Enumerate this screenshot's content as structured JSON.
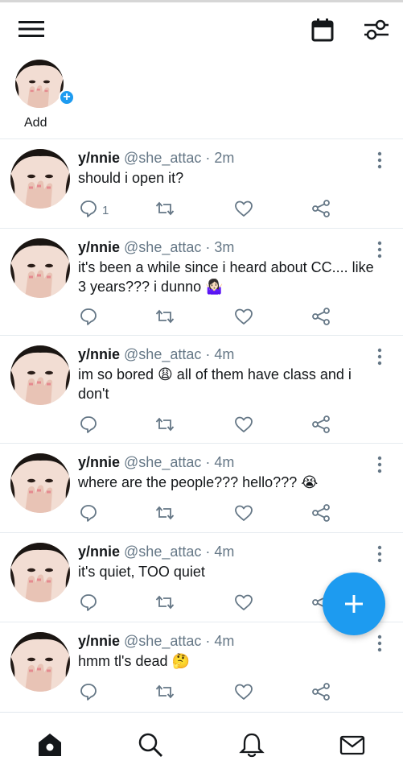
{
  "colors": {
    "accent": "#1d9bf0",
    "text": "#14171a",
    "muted": "#657786",
    "divider": "#e6ecf0"
  },
  "topbar": {
    "menu_icon": "hamburger-menu-icon",
    "calendar_icon": "calendar-icon",
    "filter_icon": "sliders-icon"
  },
  "fleets": {
    "add_label": "Add"
  },
  "tweets": [
    {
      "name": "y/nnie",
      "meta": "@she_attac · 2m",
      "text": "should i open it?",
      "reply_count": "1"
    },
    {
      "name": "y/nnie",
      "meta": "@she_attac · 3m",
      "text": "it's been a while since i heard about CC.... like 3 years??? i dunno 🤷🏻‍♀️",
      "reply_count": ""
    },
    {
      "name": "y/nnie",
      "meta": "@she_attac · 4m",
      "text": "im so bored 😩 all of them have class and i don't",
      "reply_count": ""
    },
    {
      "name": "y/nnie",
      "meta": "@she_attac · 4m",
      "text": "where are the people??? hello??? 😭",
      "reply_count": ""
    },
    {
      "name": "y/nnie",
      "meta": "@she_attac · 4m",
      "text": "it's quiet, TOO quiet",
      "reply_count": ""
    },
    {
      "name": "y/nnie",
      "meta": "@she_attac · 4m",
      "text": "hmm tl's dead 🤔",
      "reply_count": ""
    }
  ],
  "fab": {
    "icon": "plus-icon"
  },
  "bottom_nav": [
    "home-icon",
    "search-icon",
    "bell-icon",
    "mail-icon"
  ]
}
